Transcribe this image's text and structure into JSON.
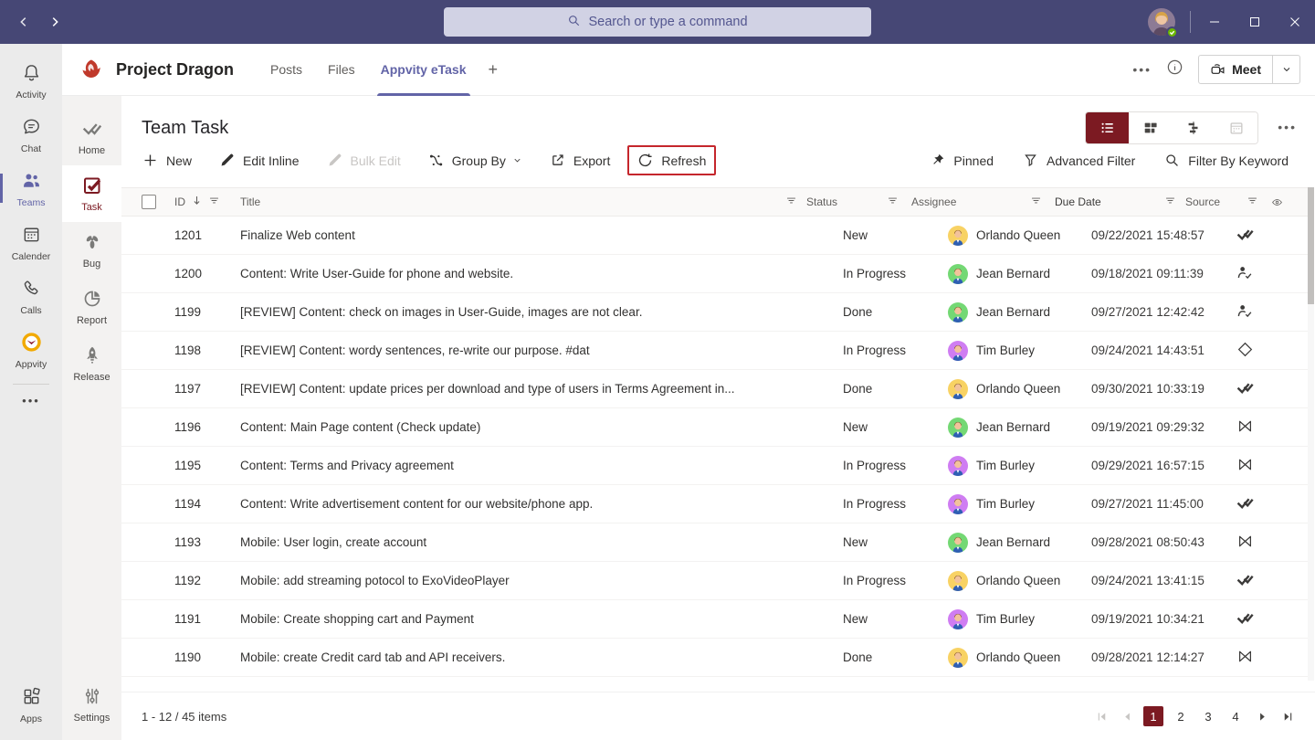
{
  "titlebar": {
    "search_placeholder": "Search or type a command"
  },
  "app_rail": {
    "items": [
      {
        "label": "Activity",
        "icon": "bell",
        "active": false
      },
      {
        "label": "Chat",
        "icon": "chat",
        "active": false
      },
      {
        "label": "Teams",
        "icon": "teams",
        "active": true
      },
      {
        "label": "Calender",
        "icon": "calendar",
        "active": false
      },
      {
        "label": "Calls",
        "icon": "calls",
        "active": false
      },
      {
        "label": "Appvity",
        "icon": "appvity",
        "active": false
      }
    ],
    "more_label": "•••",
    "apps_label": "Apps"
  },
  "team_header": {
    "team_name": "Project Dragon",
    "tabs": [
      {
        "label": "Posts",
        "active": false
      },
      {
        "label": "Files",
        "active": false
      },
      {
        "label": "Appvity eTask",
        "active": true
      }
    ],
    "add_tab_label": "+",
    "meet_label": "Meet"
  },
  "module_rail": {
    "items": [
      {
        "label": "Home",
        "icon": "home",
        "active": false
      },
      {
        "label": "Task",
        "icon": "task",
        "active": true
      },
      {
        "label": "Bug",
        "icon": "bug",
        "active": false
      },
      {
        "label": "Report",
        "icon": "report",
        "active": false
      },
      {
        "label": "Release",
        "icon": "release",
        "active": false
      }
    ],
    "settings_label": "Settings"
  },
  "page": {
    "title": "Team Task",
    "toolbar": [
      {
        "label": "New",
        "icon": "plus",
        "disabled": false,
        "highlighted": false,
        "chevron": false
      },
      {
        "label": "Edit Inline",
        "icon": "pencil",
        "disabled": false,
        "highlighted": false,
        "chevron": false
      },
      {
        "label": "Bulk Edit",
        "icon": "pencil",
        "disabled": true,
        "highlighted": false,
        "chevron": false
      },
      {
        "label": "Group By",
        "icon": "groupby",
        "disabled": false,
        "highlighted": false,
        "chevron": true
      },
      {
        "label": "Export",
        "icon": "export",
        "disabled": false,
        "highlighted": false,
        "chevron": false
      },
      {
        "label": "Refresh",
        "icon": "refresh",
        "disabled": false,
        "highlighted": true,
        "chevron": false
      }
    ],
    "filter_bar": [
      {
        "label": "Pinned",
        "icon": "pin"
      },
      {
        "label": "Advanced Filter",
        "icon": "funnel"
      },
      {
        "label": "Filter By Keyword",
        "icon": "search"
      }
    ],
    "views": [
      {
        "name": "list-view",
        "icon": "view-list",
        "active": true,
        "disabled": false
      },
      {
        "name": "board-view",
        "icon": "view-board",
        "active": false,
        "disabled": false
      },
      {
        "name": "gantt-view",
        "icon": "view-gantt",
        "active": false,
        "disabled": false
      },
      {
        "name": "calendar-view",
        "icon": "view-calendar",
        "active": false,
        "disabled": true
      }
    ]
  },
  "table": {
    "columns": [
      "ID",
      "Title",
      "Status",
      "Assignee",
      "Due Date",
      "Source"
    ],
    "rows": [
      {
        "id": "1201",
        "title": "Finalize Web content",
        "status": "New",
        "assignee": "Orlando Queen",
        "avatar_color": "#f8d264",
        "due": "09/22/2021 15:48:57",
        "source_icon": "src-etask"
      },
      {
        "id": "1200",
        "title": "Content: Write User-Guide for phone and website.",
        "status": "In Progress",
        "assignee": "Jean Bernard",
        "avatar_color": "#74d874",
        "due": "09/18/2021 09:11:39",
        "source_icon": "src-person-check"
      },
      {
        "id": "1199",
        "title": "[REVIEW] Content: check on images in User-Guide, images are not clear.",
        "status": "Done",
        "assignee": "Jean Bernard",
        "avatar_color": "#74d874",
        "due": "09/27/2021 12:42:42",
        "source_icon": "src-person-check"
      },
      {
        "id": "1198",
        "title": "[REVIEW] Content: wordy sentences, re-write our purpose. #dat",
        "status": "In Progress",
        "assignee": "Tim Burley",
        "avatar_color": "#cf7df2",
        "due": "09/24/2021 14:43:51",
        "source_icon": "src-diamond"
      },
      {
        "id": "1197",
        "title": "[REVIEW] Content: update prices per download and type of users in Terms Agreement in...",
        "status": "Done",
        "assignee": "Orlando Queen",
        "avatar_color": "#f8d264",
        "due": "09/30/2021 10:33:19",
        "source_icon": "src-etask"
      },
      {
        "id": "1196",
        "title": "Content: Main Page content (Check update)",
        "status": "New",
        "assignee": "Jean Bernard",
        "avatar_color": "#74d874",
        "due": "09/19/2021 09:29:32",
        "source_icon": "src-bowtie"
      },
      {
        "id": "1195",
        "title": "Content: Terms and Privacy agreement",
        "status": "In Progress",
        "assignee": "Tim Burley",
        "avatar_color": "#cf7df2",
        "due": "09/29/2021 16:57:15",
        "source_icon": "src-bowtie"
      },
      {
        "id": "1194",
        "title": "Content: Write advertisement content for our website/phone app.",
        "status": "In Progress",
        "assignee": "Tim Burley",
        "avatar_color": "#cf7df2",
        "due": "09/27/2021 11:45:00",
        "source_icon": "src-etask"
      },
      {
        "id": "1193",
        "title": "Mobile: User login, create account",
        "status": "New",
        "assignee": "Jean Bernard",
        "avatar_color": "#74d874",
        "due": "09/28/2021 08:50:43",
        "source_icon": "src-bowtie"
      },
      {
        "id": "1192",
        "title": "Mobile: add streaming potocol to ExoVideoPlayer",
        "status": "In Progress",
        "assignee": "Orlando Queen",
        "avatar_color": "#f8d264",
        "due": "09/24/2021 13:41:15",
        "source_icon": "src-etask"
      },
      {
        "id": "1191",
        "title": "Mobile: Create shopping cart and Payment",
        "status": "New",
        "assignee": "Tim Burley",
        "avatar_color": "#cf7df2",
        "due": "09/19/2021 10:34:21",
        "source_icon": "src-etask"
      },
      {
        "id": "1190",
        "title": "Mobile: create Credit card tab and API receivers.",
        "status": "Done",
        "assignee": "Orlando Queen",
        "avatar_color": "#f8d264",
        "due": "09/28/2021 12:14:27",
        "source_icon": "src-bowtie"
      }
    ]
  },
  "footer": {
    "summary": "1 - 12 / 45 items",
    "pages": [
      "1",
      "2",
      "3",
      "4"
    ],
    "active_page": "1"
  },
  "colors": {
    "titlebar_purple": "#464775",
    "teams_purple": "#6264a7",
    "etask_maroon": "#7c1a22",
    "highlight_red": "#c5262c"
  }
}
